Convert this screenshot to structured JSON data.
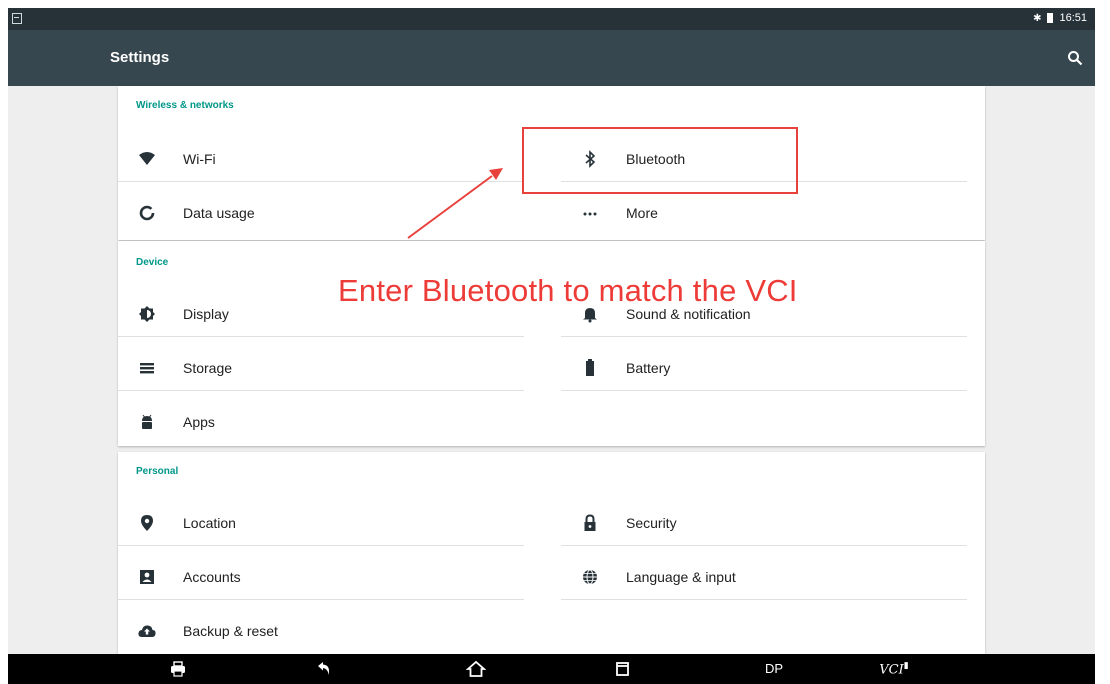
{
  "status_bar": {
    "time": "16:51",
    "bluetooth_icon": "bluetooth-icon",
    "battery_icon": "battery-icon",
    "left_icon": "notification-icon"
  },
  "app_bar": {
    "title": "Settings",
    "search_icon": "search-icon"
  },
  "sections": {
    "wireless": {
      "title": "Wireless & networks",
      "items": [
        {
          "label": "Wi-Fi",
          "icon": "wifi-icon"
        },
        {
          "label": "Bluetooth",
          "icon": "bluetooth-icon"
        },
        {
          "label": "Data usage",
          "icon": "data-usage-icon"
        },
        {
          "label": "More",
          "icon": "more-icon"
        }
      ]
    },
    "device": {
      "title": "Device",
      "items": [
        {
          "label": "Display",
          "icon": "display-icon"
        },
        {
          "label": "Sound & notification",
          "icon": "bell-icon"
        },
        {
          "label": "Storage",
          "icon": "storage-icon"
        },
        {
          "label": "Battery",
          "icon": "battery-icon"
        },
        {
          "label": "Apps",
          "icon": "android-icon"
        }
      ]
    },
    "personal": {
      "title": "Personal",
      "items": [
        {
          "label": "Location",
          "icon": "location-icon"
        },
        {
          "label": "Security",
          "icon": "lock-icon"
        },
        {
          "label": "Accounts",
          "icon": "accounts-icon"
        },
        {
          "label": "Language & input",
          "icon": "globe-icon"
        },
        {
          "label": "Backup & reset",
          "icon": "cloud-upload-icon"
        }
      ]
    }
  },
  "annotation": {
    "text": "Enter Bluetooth to match the VCI",
    "color": "#ed3b38"
  },
  "nav_bar": {
    "dp_label": "DP",
    "vci_label": "VCI"
  },
  "colors": {
    "accent": "#009688",
    "app_bar": "#37474f",
    "status_bar": "#263238",
    "highlight": "#e8413c"
  }
}
